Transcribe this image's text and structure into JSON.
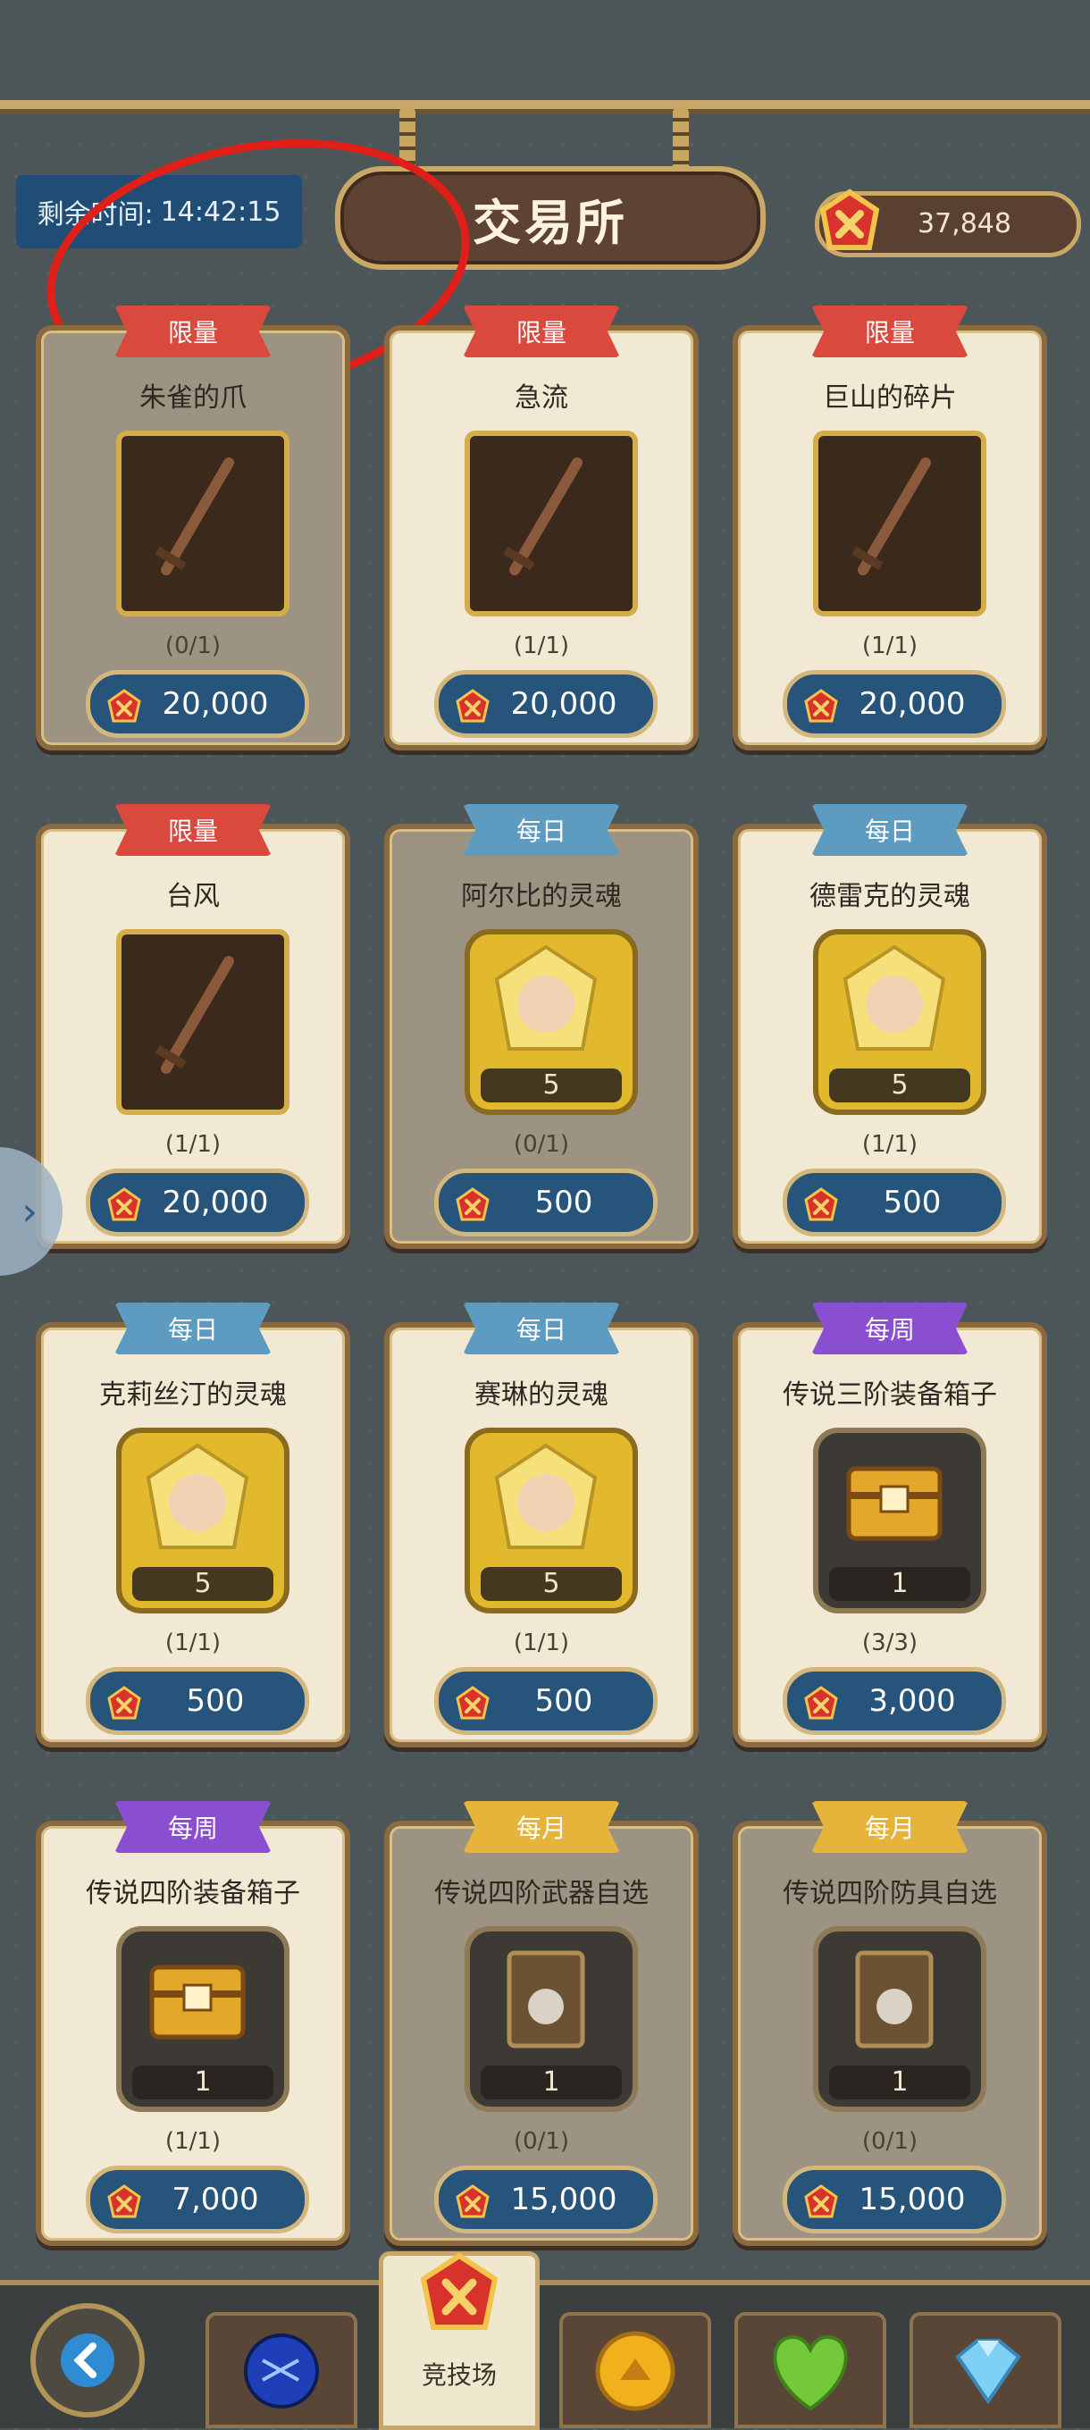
{
  "header": {
    "timer_label": "剩余时间:",
    "timer_value": "14:42:15",
    "title": "交易所",
    "currency_amount": "37,848"
  },
  "items": [
    {
      "tag": "限量",
      "name": "朱雀的爪",
      "kind": "weapon",
      "qty": "",
      "limit": "(0/1)",
      "price": "20,000",
      "state": "done"
    },
    {
      "tag": "限量",
      "name": "急流",
      "kind": "weapon",
      "qty": "",
      "limit": "(1/1)",
      "price": "20,000",
      "state": "avail"
    },
    {
      "tag": "限量",
      "name": "巨山的碎片",
      "kind": "weapon",
      "qty": "",
      "limit": "(1/1)",
      "price": "20,000",
      "state": "avail"
    },
    {
      "tag": "限量",
      "name": "台风",
      "kind": "weapon",
      "qty": "",
      "limit": "(1/1)",
      "price": "20,000",
      "state": "avail"
    },
    {
      "tag": "每日",
      "name": "阿尔比的灵魂",
      "kind": "soul",
      "qty": "5",
      "limit": "(0/1)",
      "price": "500",
      "state": "done"
    },
    {
      "tag": "每日",
      "name": "德雷克的灵魂",
      "kind": "soul",
      "qty": "5",
      "limit": "(1/1)",
      "price": "500",
      "state": "avail"
    },
    {
      "tag": "每日",
      "name": "克莉丝汀的灵魂",
      "kind": "soul",
      "qty": "5",
      "limit": "(1/1)",
      "price": "500",
      "state": "avail"
    },
    {
      "tag": "每日",
      "name": "赛琳的灵魂",
      "kind": "soul",
      "qty": "5",
      "limit": "(1/1)",
      "price": "500",
      "state": "avail"
    },
    {
      "tag": "每周",
      "name": "传说三阶装备箱子",
      "kind": "chest",
      "qty": "1",
      "limit": "(3/3)",
      "price": "3,000",
      "state": "avail"
    },
    {
      "tag": "每周",
      "name": "传说四阶装备箱子",
      "kind": "chest",
      "qty": "1",
      "limit": "(1/1)",
      "price": "7,000",
      "state": "avail"
    },
    {
      "tag": "每月",
      "name": "传说四阶武器自选",
      "kind": "select",
      "qty": "1",
      "limit": "(0/1)",
      "price": "15,000",
      "state": "done"
    },
    {
      "tag": "每月",
      "name": "传说四阶防具自选",
      "kind": "select",
      "qty": "1",
      "limit": "(0/1)",
      "price": "15,000",
      "state": "done"
    }
  ],
  "nav": {
    "active_label": "竞技场"
  },
  "colors": {
    "accent_gold": "#caa865",
    "price_blue": "#27547a",
    "annotation_red": "#e02018"
  }
}
